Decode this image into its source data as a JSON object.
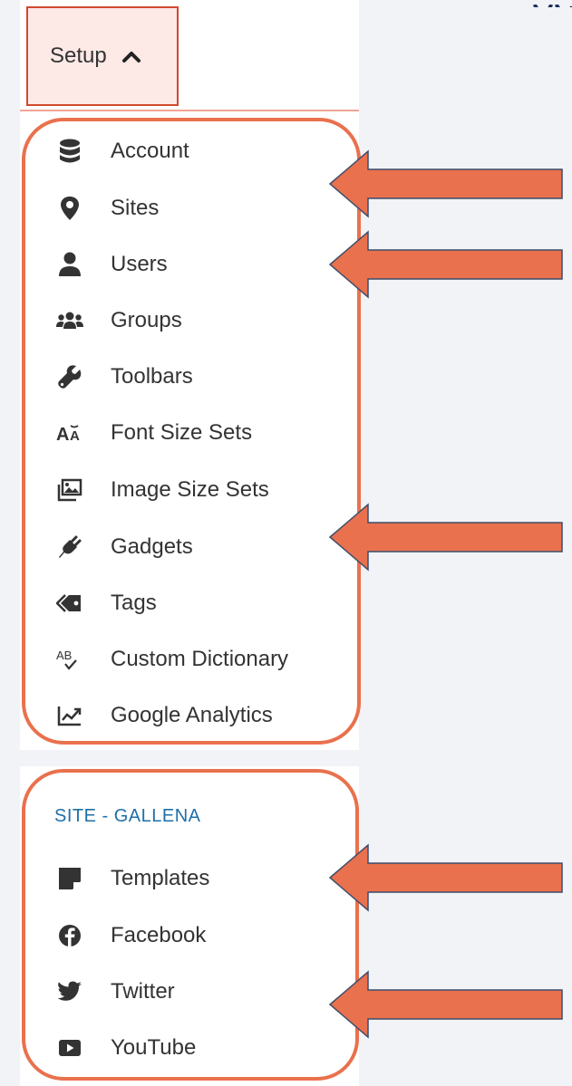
{
  "setup": {
    "label": "Setup",
    "expanded_icon": "chevron-up-icon"
  },
  "menu": {
    "items": [
      {
        "label": "Account",
        "icon": "database-icon"
      },
      {
        "label": "Sites",
        "icon": "map-marker-icon"
      },
      {
        "label": "Users",
        "icon": "user-icon"
      },
      {
        "label": "Groups",
        "icon": "users-group-icon"
      },
      {
        "label": "Toolbars",
        "icon": "wrench-icon"
      },
      {
        "label": "Font Size Sets",
        "icon": "font-size-icon"
      },
      {
        "label": "Image Size Sets",
        "icon": "image-icon"
      },
      {
        "label": "Gadgets",
        "icon": "plug-icon"
      },
      {
        "label": "Tags",
        "icon": "tags-icon"
      },
      {
        "label": "Custom Dictionary",
        "icon": "spellcheck-icon"
      },
      {
        "label": "Google Analytics",
        "icon": "chart-line-icon"
      }
    ]
  },
  "site": {
    "section_label": "SITE - GALLENA",
    "items": [
      {
        "label": "Templates",
        "icon": "sticky-note-icon"
      },
      {
        "label": "Facebook",
        "icon": "facebook-icon"
      },
      {
        "label": "Twitter",
        "icon": "twitter-icon"
      },
      {
        "label": "YouTube",
        "icon": "youtube-icon"
      }
    ]
  },
  "annotations": {
    "arrow_color": "#e9714e",
    "outline_color": "#e9714e"
  }
}
